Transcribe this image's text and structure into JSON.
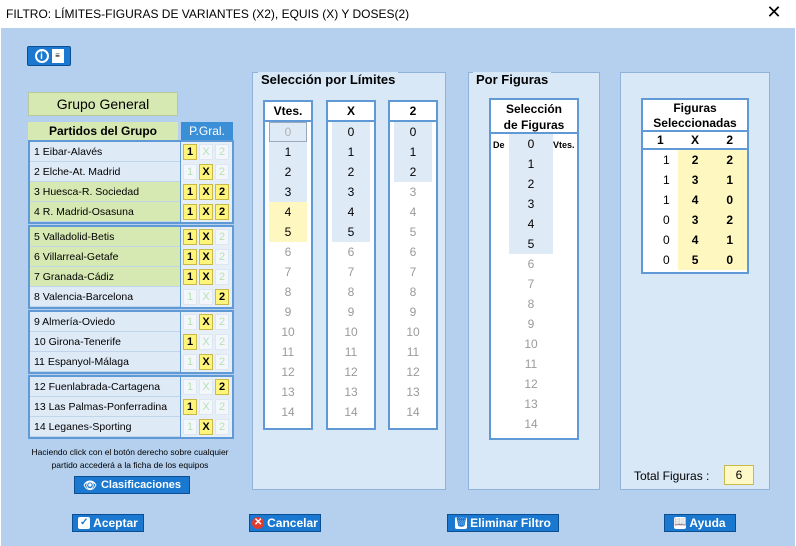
{
  "window": {
    "title": "FILTRO: LÍMITES-FIGURAS DE VARIANTES (X2), EQUIS (X) Y DOSES(2)",
    "close_glyph": "✕"
  },
  "group": {
    "title": "Grupo General",
    "matches_header": "Partidos del Grupo",
    "pgral_header": "P.Gral."
  },
  "matches": [
    {
      "label": "1 Eibar-Alavés",
      "highlight": false,
      "signs": [
        true,
        false,
        false
      ]
    },
    {
      "label": "2 Elche-At. Madrid",
      "highlight": false,
      "signs": [
        false,
        true,
        false
      ]
    },
    {
      "label": "3 Huesca-R. Sociedad",
      "highlight": true,
      "signs": [
        true,
        true,
        true
      ]
    },
    {
      "label": "4 R. Madrid-Osasuna",
      "highlight": true,
      "signs": [
        true,
        true,
        true
      ]
    },
    {
      "label": "5 Valladolid-Betis",
      "highlight": true,
      "signs": [
        true,
        true,
        false
      ]
    },
    {
      "label": "6 Villarreal-Getafe",
      "highlight": true,
      "signs": [
        true,
        true,
        false
      ]
    },
    {
      "label": "7 Granada-Cádiz",
      "highlight": true,
      "signs": [
        true,
        true,
        false
      ]
    },
    {
      "label": "8 Valencia-Barcelona",
      "highlight": false,
      "signs": [
        false,
        false,
        true
      ]
    },
    {
      "label": "9 Almería-Oviedo",
      "highlight": false,
      "signs": [
        false,
        true,
        false
      ]
    },
    {
      "label": "10 Girona-Tenerife",
      "highlight": false,
      "signs": [
        true,
        false,
        false
      ]
    },
    {
      "label": "11 Espanyol-Málaga",
      "highlight": false,
      "signs": [
        false,
        true,
        false
      ]
    },
    {
      "label": "12 Fuenlabrada-Cartagena",
      "highlight": false,
      "signs": [
        false,
        false,
        true
      ]
    },
    {
      "label": "13 Las Palmas-Ponferradina",
      "highlight": false,
      "signs": [
        true,
        false,
        false
      ]
    },
    {
      "label": "14 Leganes-Sporting",
      "highlight": false,
      "signs": [
        false,
        true,
        false
      ]
    }
  ],
  "sign_labels": [
    "1",
    "X",
    "2"
  ],
  "hint": "Haciendo click con el botón derecho sobre cualquier partido accederá a la ficha de los equipos",
  "clasificaciones_label": "Clasificaciones",
  "limits": {
    "title": "Selección por Límites",
    "columns": [
      {
        "header": "Vtes.",
        "first_zero_boxed": true,
        "active": [
          1,
          2,
          3
        ],
        "selected": [
          4,
          5
        ]
      },
      {
        "header": "X",
        "first_zero_boxed": false,
        "active": [
          0,
          1,
          2,
          3,
          4,
          5
        ],
        "selected": []
      },
      {
        "header": "2",
        "first_zero_boxed": false,
        "active": [
          0,
          1,
          2
        ],
        "selected": []
      }
    ],
    "values": [
      "0",
      "1",
      "2",
      "3",
      "4",
      "5",
      "6",
      "7",
      "8",
      "9",
      "10",
      "11",
      "12",
      "13",
      "14"
    ]
  },
  "figures": {
    "title": "Por Figuras",
    "box_title_1": "Selección",
    "box_title_2": "de Figuras",
    "de_label": "De",
    "vtes_label": "Vtes.",
    "active": [
      0,
      1,
      2,
      3,
      4,
      5
    ]
  },
  "selected_figures": {
    "title_1": "Figuras",
    "title_2": "Seleccionadas",
    "headers": [
      "1",
      "X",
      "2"
    ],
    "rows": [
      [
        "1",
        "2",
        "2"
      ],
      [
        "1",
        "3",
        "1"
      ],
      [
        "1",
        "4",
        "0"
      ],
      [
        "0",
        "3",
        "2"
      ],
      [
        "0",
        "4",
        "1"
      ],
      [
        "0",
        "5",
        "0"
      ]
    ]
  },
  "total": {
    "label": "Total Figuras :",
    "value": "6"
  },
  "buttons": {
    "accept": "Aceptar",
    "cancel": "Cancelar",
    "clear_filter": "Eliminar Filtro",
    "help": "Ayuda"
  }
}
